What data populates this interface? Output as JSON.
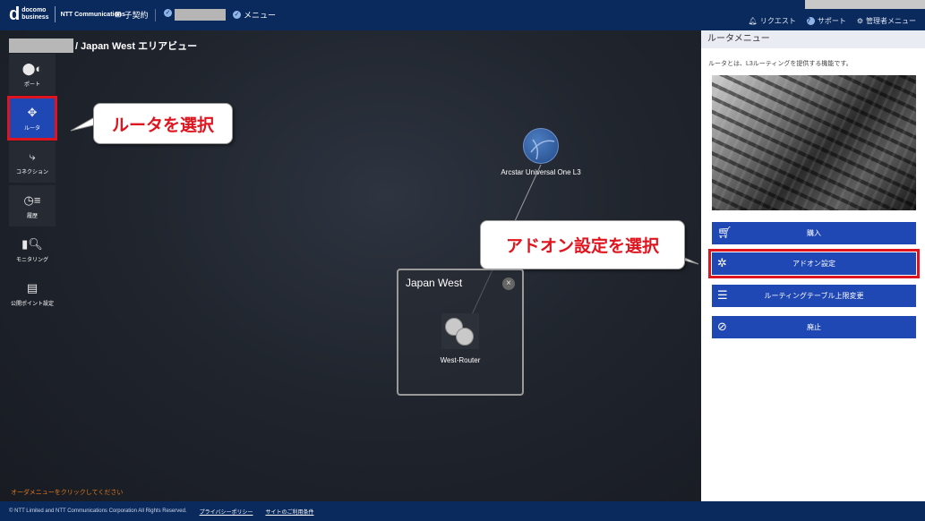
{
  "header": {
    "brand_lines": [
      "docomo",
      "business"
    ],
    "brand_partner": "NTT Communications",
    "contract_label": "子契約",
    "menu_label": "メニュー",
    "right_links": [
      "リクエスト",
      "サポート",
      "管理者メニュー"
    ]
  },
  "breadcrumb": {
    "title": "/ Japan West エリアビュー"
  },
  "sidebar": {
    "items": [
      {
        "label": "ポート",
        "icon": "port-icon"
      },
      {
        "label": "ルータ",
        "icon": "router-icon",
        "active": true
      },
      {
        "label": "コネクション",
        "icon": "connection-icon"
      },
      {
        "label": "履歴",
        "icon": "history-icon"
      },
      {
        "label": "モニタリング",
        "icon": "monitoring-icon"
      },
      {
        "label": "公開ポイント設定",
        "icon": "public-point-icon"
      }
    ]
  },
  "callouts": {
    "router": "ルータを選択",
    "addon": "アドオン設定を選択"
  },
  "topology": {
    "cloud_label": "Arcstar Universal One L3",
    "area_title": "Japan West",
    "router_label": "West-Router"
  },
  "hint": "オーダメニューをクリックしてください",
  "panel": {
    "title": "ルータメニュー",
    "description": "ルータとは、L3ルーティングを提供する機能です。",
    "buttons": [
      {
        "label": "購入",
        "icon": "cart-icon"
      },
      {
        "label": "アドオン設定",
        "icon": "puzzle-icon",
        "selected": true
      },
      {
        "label": "ルーティングテーブル上限変更",
        "icon": "sliders-icon"
      },
      {
        "label": "廃止",
        "icon": "ban-icon"
      }
    ]
  },
  "footer": {
    "copyright": "© NTT Limited and NTT Communications Corporation All Rights Reserved.",
    "privacy": "プライバシーポリシー",
    "terms": "サイトのご利用条件"
  },
  "colors": {
    "header_bg": "#0a2a5e",
    "accent_blue": "#1f48b5",
    "highlight_red": "#e0141e"
  }
}
